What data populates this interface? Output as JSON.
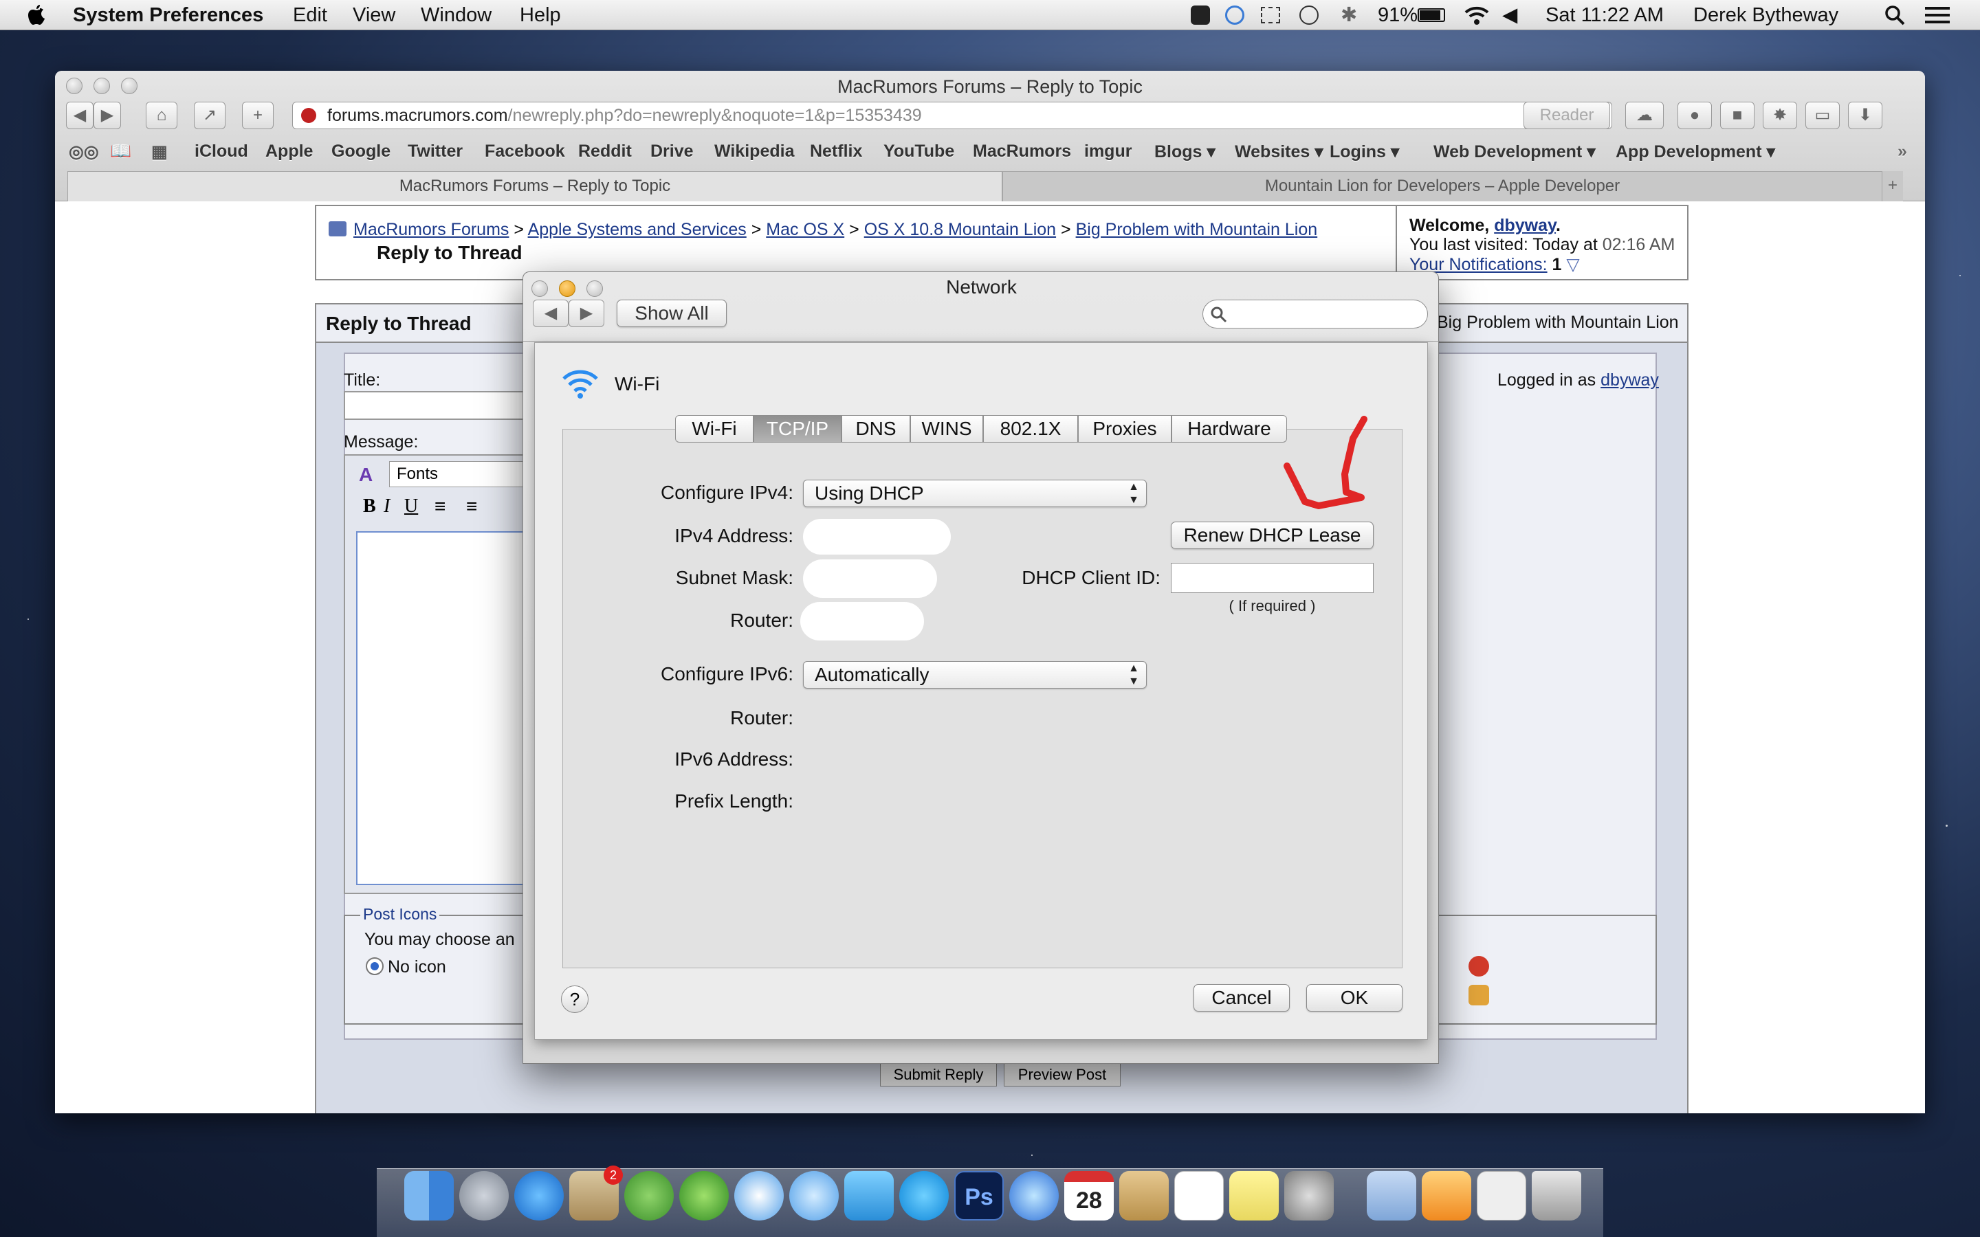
{
  "menubar": {
    "app": "System Preferences",
    "menus": [
      "Edit",
      "View",
      "Window",
      "Help"
    ],
    "battery": "91%",
    "clock": "Sat 11:22 AM",
    "user": "Derek Bytheway"
  },
  "safari": {
    "title": "MacRumors Forums – Reply to Topic",
    "url_domain": "forums.macrumors.com",
    "url_path": "/newreply.php?do=newreply&noquote=1&p=15353439",
    "reader_label": "Reader",
    "bookmarks": [
      "iCloud",
      "Apple",
      "Google",
      "Twitter",
      "Facebook",
      "Reddit",
      "Drive",
      "Wikipedia",
      "Netflix",
      "YouTube",
      "MacRumors",
      "imgur",
      "Blogs ▾",
      "Websites ▾",
      "Logins ▾",
      "Web Development ▾",
      "App Development ▾"
    ],
    "tabs": [
      "MacRumors Forums – Reply to Topic",
      "Mountain Lion for Developers – Apple Developer"
    ]
  },
  "forum": {
    "breadcrumb": [
      "MacRumors Forums",
      "Apple Systems and Services",
      "Mac OS X",
      "OS X 10.8 Mountain Lion",
      "Big Problem with Mountain Lion"
    ],
    "sep": ">",
    "page_title": "Reply to Thread",
    "welcome": "Welcome,",
    "username": "dbyway",
    "last_visited": "You last visited: Today at",
    "last_visited_time": "02:16 AM",
    "notifications_label": "Your Notifications:",
    "notifications_count": "1",
    "panel_title": "Reply to Thread",
    "thread_title": "Big Problem with Mountain Lion",
    "logged_in": "Logged in as",
    "title_label": "Title:",
    "message_label": "Message:",
    "fonts_label": "Fonts",
    "post_icons_legend": "Post Icons",
    "post_icons_text": "You may choose an",
    "no_icon": "No icon",
    "submit": "Submit Reply",
    "preview": "Preview Post"
  },
  "network": {
    "window_title": "Network",
    "show_all": "Show All",
    "search_placeholder": "",
    "interface_name": "Wi-Fi",
    "tabs": [
      "Wi-Fi",
      "TCP/IP",
      "DNS",
      "WINS",
      "802.1X",
      "Proxies",
      "Hardware"
    ],
    "selected_tab": "TCP/IP",
    "configure_ipv4_label": "Configure IPv4:",
    "configure_ipv4_value": "Using DHCP",
    "ipv4_address_label": "IPv4 Address:",
    "subnet_mask_label": "Subnet Mask:",
    "router_label": "Router:",
    "renew_button": "Renew DHCP Lease",
    "dhcp_client_id_label": "DHCP Client ID:",
    "dhcp_client_id_value": "",
    "if_required": "( If required )",
    "configure_ipv6_label": "Configure IPv6:",
    "configure_ipv6_value": "Automatically",
    "router6_label": "Router:",
    "ipv6_address_label": "IPv6 Address:",
    "prefix_length_label": "Prefix Length:",
    "help": "?",
    "cancel": "Cancel",
    "ok": "OK"
  },
  "dock": {
    "calendar_day": "28",
    "mail_badge": "2"
  }
}
